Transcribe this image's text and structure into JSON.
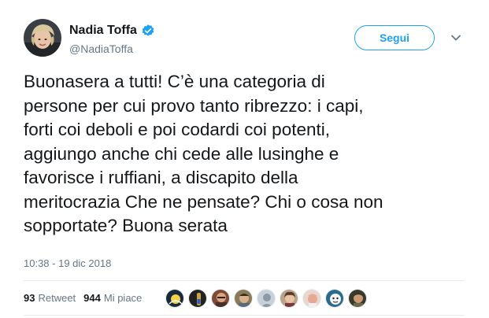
{
  "author": {
    "name": "Nadia Toffa",
    "handle": "@NadiaToffa",
    "verified_icon": "verified-badge-icon"
  },
  "actions": {
    "follow_label": "Segui",
    "caret_icon": "chevron-down-icon"
  },
  "tweet": {
    "lines": [
      "Buonasera a tutti! C’è una categoria di",
      "persone per cui provo tanto ribrezzo: i capi,",
      "forti coi deboli e poi codardi coi potenti,",
      "aggiungo anche chi cede alle lusinghe e",
      "favorisce i ruffiani, a discapito della",
      "meritocrazia Che ne pensate? Chi o cosa non",
      "sopportate? Buona serata"
    ],
    "timestamp": "10:38 - 19 dic 2018"
  },
  "stats": {
    "retweets_count": "93",
    "retweets_label": "Retweet",
    "likes_count": "944",
    "likes_label": "Mi piace"
  },
  "colors": {
    "accent": "#1da1f2",
    "text": "#14171a",
    "muted": "#657786",
    "divider": "#e6ecf0"
  }
}
